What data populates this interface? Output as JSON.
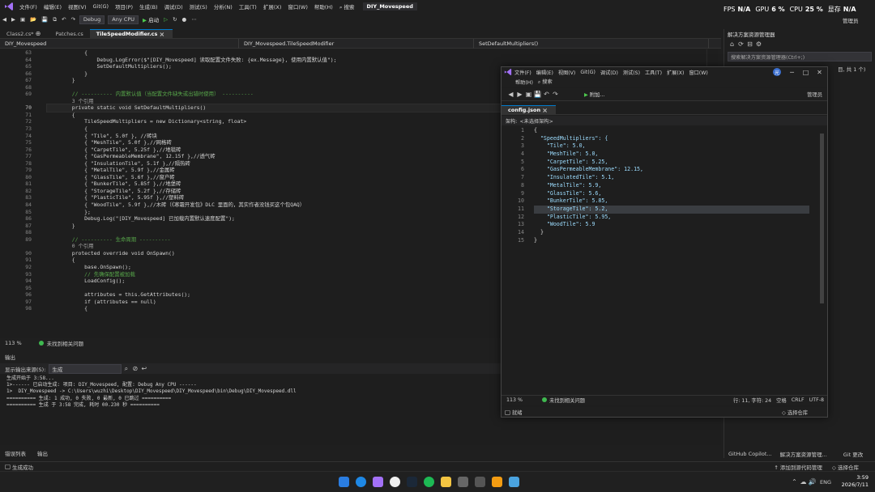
{
  "menubar": {
    "items": [
      "文件(F)",
      "编辑(E)",
      "视图(V)",
      "Git(G)",
      "项目(P)",
      "生成(B)",
      "调试(D)",
      "测试(S)",
      "分析(N)",
      "工具(T)",
      "扩展(X)",
      "窗口(W)",
      "帮助(H)"
    ],
    "search_label": "搜索",
    "solution_title": "DIY_Movespeed"
  },
  "toolbar": {
    "config": "Debug",
    "platform": "Any CPU",
    "run_label": "启动"
  },
  "perf": {
    "fps_label": "FPS",
    "fps": "N/A",
    "gpu_label": "GPU",
    "gpu": "6 %",
    "cpu_label": "CPU",
    "cpu": "25 %",
    "mem_label": "显存",
    "mem": "N/A",
    "admin": "管理员"
  },
  "editor": {
    "tabs": [
      {
        "label": "Class2.cs*"
      },
      {
        "label": "Patches.cs"
      },
      {
        "label": "TileSpeedModifier.cs"
      }
    ],
    "nav": [
      "DIY_Movespeed",
      "DIY_Movespeed.TileSpeedModifier",
      "SetDefaultMultipliers()"
    ],
    "lines": [
      {
        "n": "63",
        "t": "            {"
      },
      {
        "n": "64",
        "t": "                Debug.LogError($\"[DIY_Movespeed] 读取配置文件失败: {ex.Message}, 使用内置默认值\");"
      },
      {
        "n": "65",
        "t": "                SetDefaultMultipliers();"
      },
      {
        "n": "66",
        "t": "            }"
      },
      {
        "n": "67",
        "t": "        }"
      },
      {
        "n": "68",
        "t": ""
      },
      {
        "n": "69",
        "t": "        // ---------- 内置默认值（当配置文件缺失或出错时使用） ----------"
      },
      {
        "n": "",
        "t": "        3 个引用"
      },
      {
        "n": "70",
        "t": "        private static void SetDefaultMultipliers()"
      },
      {
        "n": "71",
        "t": "        {"
      },
      {
        "n": "72",
        "t": "            TileSpeedMultipliers = new Dictionary<string, float>"
      },
      {
        "n": "73",
        "t": "            {"
      },
      {
        "n": "74",
        "t": "            { \"Tile\", 5.0f }, //砖块"
      },
      {
        "n": "75",
        "t": "            { \"MeshTile\", 5.0f },//网格砖"
      },
      {
        "n": "76",
        "t": "            { \"CarpetTile\", 5.25f },//地毯砖"
      },
      {
        "n": "77",
        "t": "            { \"GasPermeableMembrane\", 12.15f },//透气砖"
      },
      {
        "n": "78",
        "t": "            { \"InsulationTile\", 5.1f },//隔热砖"
      },
      {
        "n": "79",
        "t": "            { \"MetalTile\", 5.9f },//金属砖"
      },
      {
        "n": "80",
        "t": "            { \"GlassTile\", 5.6f },//窗户砖"
      },
      {
        "n": "81",
        "t": "            { \"BunkerTile\", 5.85f },//地堡砖"
      },
      {
        "n": "82",
        "t": "            { \"StorageTile\", 5.2f },//存储砖"
      },
      {
        "n": "83",
        "t": "            { \"PlasticTile\", 5.95f },//塑料砖"
      },
      {
        "n": "84",
        "t": "            { \"WoodTile\", 5.9f },//木砖（《寒霜开发包》DLC 里面的，其实作者没钱买这个包QAQ）"
      },
      {
        "n": "85",
        "t": "            };"
      },
      {
        "n": "86",
        "t": "            Debug.Log(\"[DIY_Movespeed] 已加载内置默认速度配置\");"
      },
      {
        "n": "87",
        "t": "        }"
      },
      {
        "n": "88",
        "t": ""
      },
      {
        "n": "89",
        "t": "        // ---------- 生命周期 ----------"
      },
      {
        "n": "",
        "t": "        0 个引用"
      },
      {
        "n": "90",
        "t": "        protected override void OnSpawn()"
      },
      {
        "n": "91",
        "t": "        {"
      },
      {
        "n": "92",
        "t": "            base.OnSpawn();"
      },
      {
        "n": "93",
        "t": "            // 先确保配置被加载"
      },
      {
        "n": "94",
        "t": "            LoadConfig();"
      },
      {
        "n": "95",
        "t": ""
      },
      {
        "n": "96",
        "t": "            attributes = this.GetAttributes();"
      },
      {
        "n": "97",
        "t": "            if (attributes == null)"
      },
      {
        "n": "98",
        "t": "            {"
      }
    ],
    "zoom": "113 %",
    "issues": "未找到相关问题"
  },
  "output": {
    "title": "输出",
    "source_label": "显示输出来源(S):",
    "source_value": "生成",
    "lines": [
      "生成开始于 3:58...",
      "1>------ 已启动生成: 项目: DIY_Movespeed, 配置: Debug Any CPU ------",
      "1>  DIY_Movespeed -> C:\\Users\\wuzhi\\Desktop\\DIY_Movespeed\\DIY_Movespeed\\bin\\Debug\\DIY_Movespeed.dll",
      "========== 生成: 1 成功, 0 失败, 0 最新, 0 已跳过 ==========",
      "========== 生成 于 3:58 完成, 耗时 00.230 秒 =========="
    ],
    "tabs": [
      "错误列表",
      "输出"
    ]
  },
  "solution_explorer": {
    "title": "解决方案资源管理器",
    "search_placeholder": "搜索解决方案资源管理器(Ctrl+;)",
    "summary_fragment": "目, 共 1 个)",
    "bottom_tabs": [
      "GitHub Copilot...",
      "解决方案资源管理...",
      "Git 更改"
    ]
  },
  "statusbar": {
    "status": "生成成功",
    "add_source": "添加到源代码管理",
    "repo": "选择仓库"
  },
  "json_window": {
    "menu": [
      "文件(F)",
      "编辑(E)",
      "视图(V)",
      "Git(G)",
      "调试(D)",
      "测试(S)",
      "工具(T)",
      "扩展(X)",
      "窗口(W)",
      "帮助(H)"
    ],
    "search_label": "搜索",
    "avatar_letter": "光",
    "attach_label": "附加...",
    "admin": "管理员",
    "tab": "config.json",
    "schema_label": "架构:",
    "schema_value": "<未选择架构>",
    "lines": [
      {
        "n": "1",
        "t": "{"
      },
      {
        "n": "2",
        "t": "  \"SpeedMultipliers\": {"
      },
      {
        "n": "3",
        "t": "    \"Tile\": 5.0,"
      },
      {
        "n": "4",
        "t": "    \"MeshTile\": 5.0,"
      },
      {
        "n": "5",
        "t": "    \"CarpetTile\": 5.25,"
      },
      {
        "n": "6",
        "t": "    \"GasPermeableMembrane\": 12.15,"
      },
      {
        "n": "7",
        "t": "    \"InsulatedTile\": 5.1,"
      },
      {
        "n": "8",
        "t": "    \"MetalTile\": 5.9,"
      },
      {
        "n": "9",
        "t": "    \"GlassTile\": 5.6,"
      },
      {
        "n": "10",
        "t": "    \"BunkerTile\": 5.85,"
      },
      {
        "n": "11",
        "t": "    \"StorageTile\": 5.2,"
      },
      {
        "n": "12",
        "t": "    \"PlasticTile\": 5.95,"
      },
      {
        "n": "13",
        "t": "    \"WoodTile\": 5.9"
      },
      {
        "n": "14",
        "t": "  }"
      },
      {
        "n": "15",
        "t": "}"
      }
    ],
    "zoom": "113 %",
    "issues": "未找到相关问题",
    "position": "行: 11, 字符: 24",
    "spaces": "空格",
    "eol": "CRLF",
    "encoding": "UTF-8",
    "ready": "就绪",
    "repo": "选择仓库"
  },
  "taskbar": {
    "lang": "ENG",
    "time": "3:59",
    "date": "2026/7/11"
  }
}
